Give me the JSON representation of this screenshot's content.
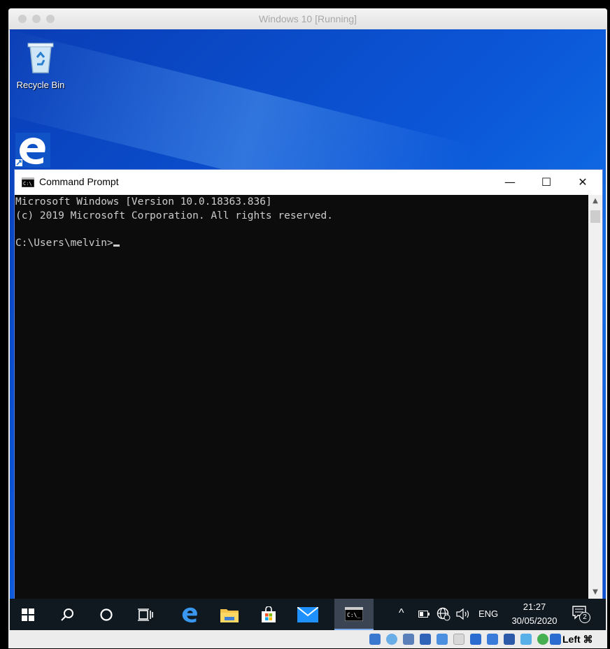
{
  "host_window": {
    "title": "Windows 10 [Running]"
  },
  "desktop": {
    "icons": [
      {
        "label": "Recycle Bin",
        "icon": "recycle-bin-icon"
      },
      {
        "label": "",
        "icon": "edge-shortcut-icon"
      }
    ]
  },
  "cmd_window": {
    "title": "Command Prompt",
    "controls": {
      "minimize": "—",
      "maximize": "☐",
      "close": "✕"
    },
    "lines": [
      "Microsoft Windows [Version 10.0.18363.836]",
      "(c) 2019 Microsoft Corporation. All rights reserved.",
      "",
      "C:\\Users\\melvin>"
    ]
  },
  "taskbar": {
    "items": [
      "start-icon",
      "search-icon",
      "cortana-icon",
      "task-view-icon",
      "edge-icon",
      "file-explorer-icon",
      "store-icon",
      "mail-icon",
      "command-prompt-icon"
    ],
    "tray": {
      "language": "ENG",
      "time": "21:27",
      "date": "30/05/2020",
      "notification_count": "2"
    }
  },
  "vbox_status": {
    "host_key": "Left ⌘"
  },
  "colors": {
    "desktop_blue": "#0b57d8",
    "taskbar": "#101820",
    "console_bg": "#0c0c0c",
    "console_text": "#cccccc"
  }
}
